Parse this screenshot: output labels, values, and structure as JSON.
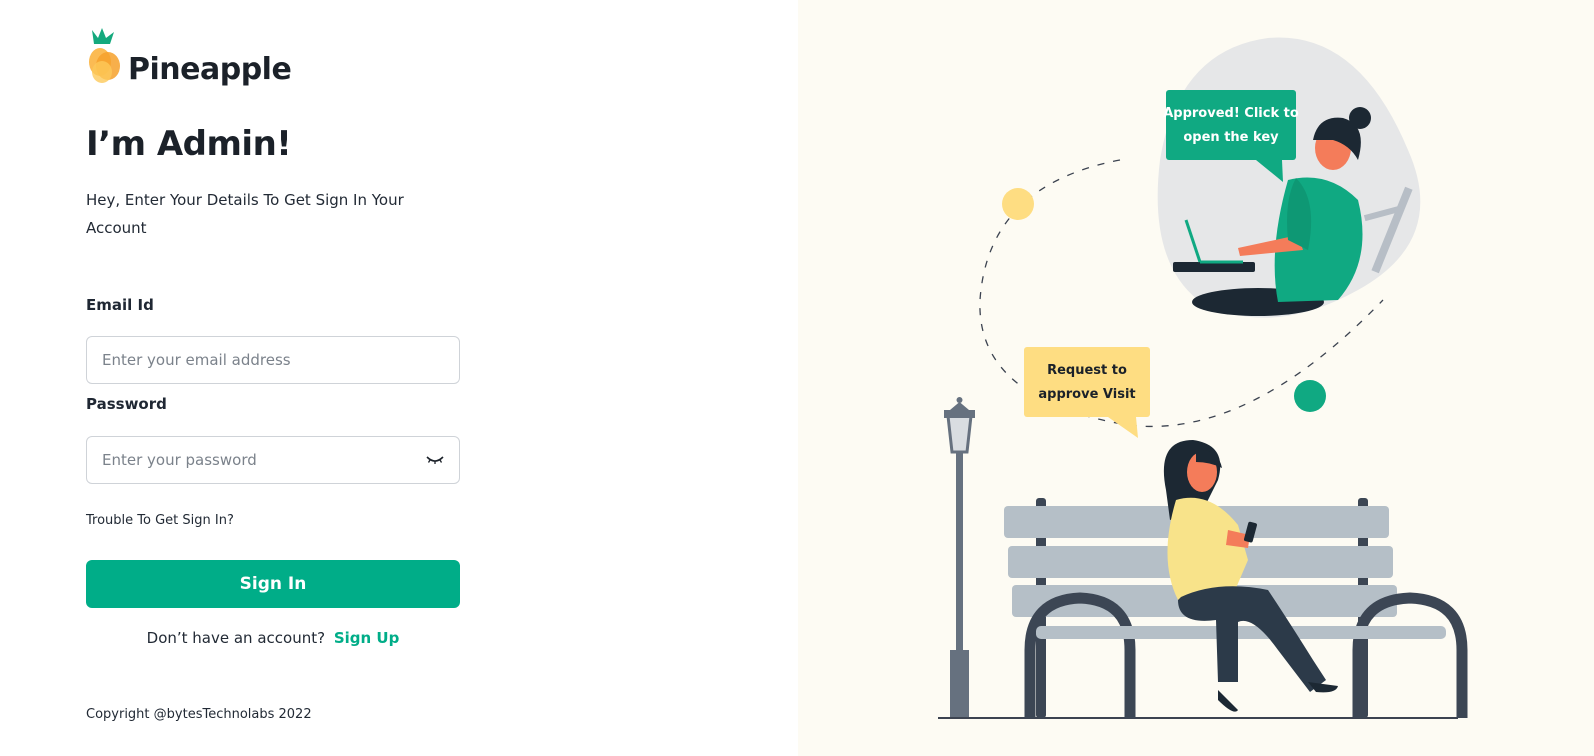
{
  "brand": {
    "name": "Pineapple"
  },
  "login": {
    "heading": "I’m Admin!",
    "subtitle": "Hey, Enter Your Details To Get Sign In Your Account",
    "email_label": "Email Id",
    "email_placeholder": "Enter your email address",
    "email_value": "",
    "password_label": "Password",
    "password_placeholder": "Enter your password",
    "password_value": "",
    "trouble_link": "Trouble To Get Sign In?",
    "signin_label": "Sign In",
    "no_account_text": "Don’t have an account?",
    "signup_link": "Sign Up"
  },
  "footer": {
    "copyright": "Copyright @bytesTechnolabs 2022"
  },
  "illustration": {
    "approved_bubble_line1": "Approved! Click to",
    "approved_bubble_line2": "open the key",
    "request_bubble_line1": "Request to",
    "request_bubble_line2": "approve Visit"
  },
  "colors": {
    "accent": "#00ad88",
    "panel_bg": "#fdfbf3",
    "bubble_yellow": "#fedd82",
    "bubble_green": "#10a982"
  },
  "icons": {
    "logo": "pineapple-logo-icon",
    "password_toggle": "eye-closed-icon"
  }
}
